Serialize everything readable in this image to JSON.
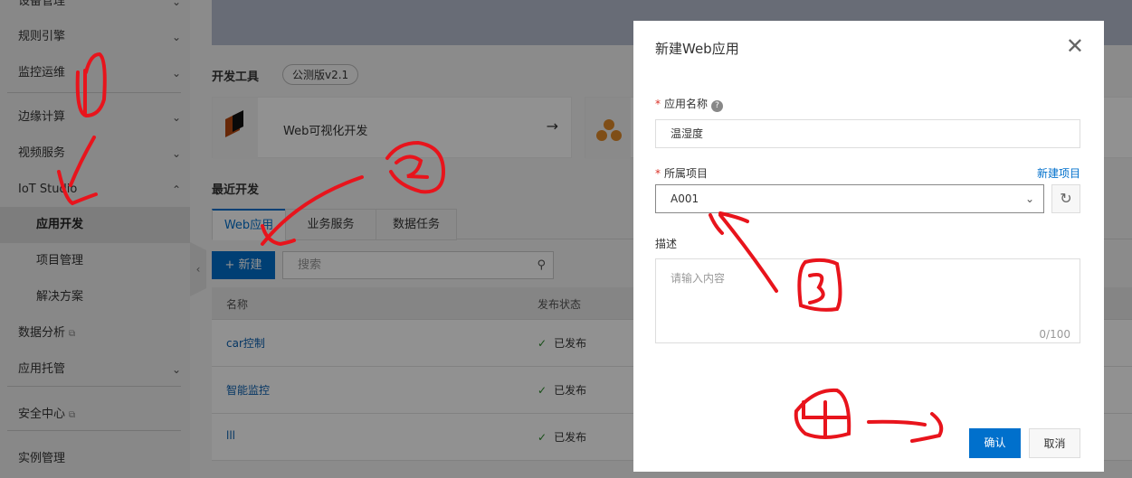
{
  "sidebar": {
    "items": [
      {
        "label": "设备管理",
        "chev": "⌄"
      },
      {
        "label": "规则引擎",
        "chev": "⌄"
      },
      {
        "label": "监控运维",
        "chev": "⌄"
      },
      {
        "label": "边缘计算",
        "chev": "⌄"
      },
      {
        "label": "视频服务",
        "chev": "⌄"
      },
      {
        "label": "IoT Studio",
        "chev": "⌃"
      },
      {
        "label": "应用开发"
      },
      {
        "label": "项目管理"
      },
      {
        "label": "解决方案"
      },
      {
        "label": "数据分析",
        "ext": "⧉"
      },
      {
        "label": "应用托管",
        "chev": "⌄"
      },
      {
        "label": "安全中心",
        "ext": "⧉"
      },
      {
        "label": "实例管理"
      }
    ]
  },
  "main": {
    "dev_tools": "开发工具",
    "version_badge": "公测版v2.1",
    "card_label": "Web可视化开发",
    "card_arrow": "→",
    "recent": "最近开发",
    "tabs": [
      "Web应用",
      "业务服务",
      "数据任务"
    ],
    "new_button": "+ 新建",
    "search_placeholder": "搜索",
    "columns": [
      "名称",
      "发布状态"
    ],
    "rows": [
      {
        "name": "car控制",
        "status": "已发布"
      },
      {
        "name": "智能监控",
        "status": "已发布"
      },
      {
        "name": "lll",
        "status": "已发布"
      }
    ]
  },
  "modal": {
    "title": "新建Web应用",
    "close": "✕",
    "name_label": "应用名称",
    "name_value": "温湿度",
    "project_label": "所属项目",
    "new_project": "新建项目",
    "project_value": "A001",
    "desc_label": "描述",
    "desc_placeholder": "请输入内容",
    "counter": "0/100",
    "confirm": "确认",
    "cancel": "取消"
  },
  "annotations": [
    "1",
    "2",
    "3",
    "4"
  ]
}
